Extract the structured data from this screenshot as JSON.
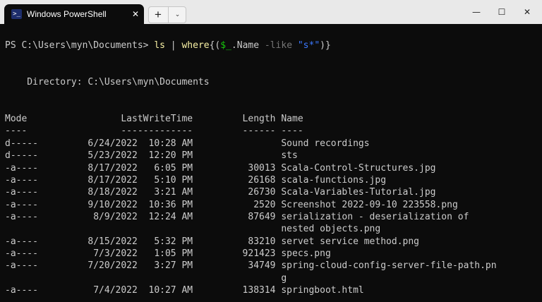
{
  "window": {
    "tab_title": "Windows PowerShell",
    "tab_icon_glyph": ">_",
    "tab_close": "✕",
    "new_tab": "+",
    "dropdown": "⌄",
    "minimize": "—",
    "maximize": "☐",
    "close": "✕"
  },
  "prompt": {
    "text": "PS C:\\Users\\myn\\Documents> ",
    "cmd_ls": "ls",
    "cmd_pipe": " | ",
    "cmd_where": "where",
    "cmd_open": "{(",
    "cmd_var": "$_",
    "cmd_prop": ".Name ",
    "cmd_param": "-like",
    "cmd_space": " ",
    "cmd_str": "\"s*\"",
    "cmd_close": ")}"
  },
  "listing": {
    "directory": "    Directory: C:\\Users\\myn\\Documents",
    "header": "Mode                 LastWriteTime         Length Name",
    "underline": "----                 -------------         ------ ----",
    "lines": [
      "d-----         6/24/2022  10:28 AM                Sound recordings",
      "d-----         5/23/2022  12:20 PM                sts",
      "-a----         8/17/2022   6:05 PM          30013 Scala-Control-Structures.jpg",
      "-a----         8/17/2022   5:10 PM          26168 scala-functions.jpg",
      "-a----         8/18/2022   3:21 AM          26730 Scala-Variables-Tutorial.jpg",
      "-a----         9/10/2022  10:36 PM           2520 Screenshot 2022-09-10 223558.png",
      "-a----          8/9/2022  12:24 AM          87649 serialization - deserialization of",
      "                                                  nested objects.png",
      "-a----         8/15/2022   5:32 PM          83210 servet service method.png",
      "-a----          7/3/2022   1:05 PM         921423 specs.png",
      "-a----         7/20/2022   3:27 PM          34749 spring-cloud-config-server-file-path.pn",
      "                                                  g",
      "-a----          7/4/2022  10:27 AM         138314 springboot.html"
    ]
  },
  "colors": {
    "background": "#0c0c0c",
    "text": "#cccccc",
    "command": "#f9f1a5",
    "variable": "#16c60c",
    "parameter": "#767676",
    "string": "#3b78ff"
  }
}
